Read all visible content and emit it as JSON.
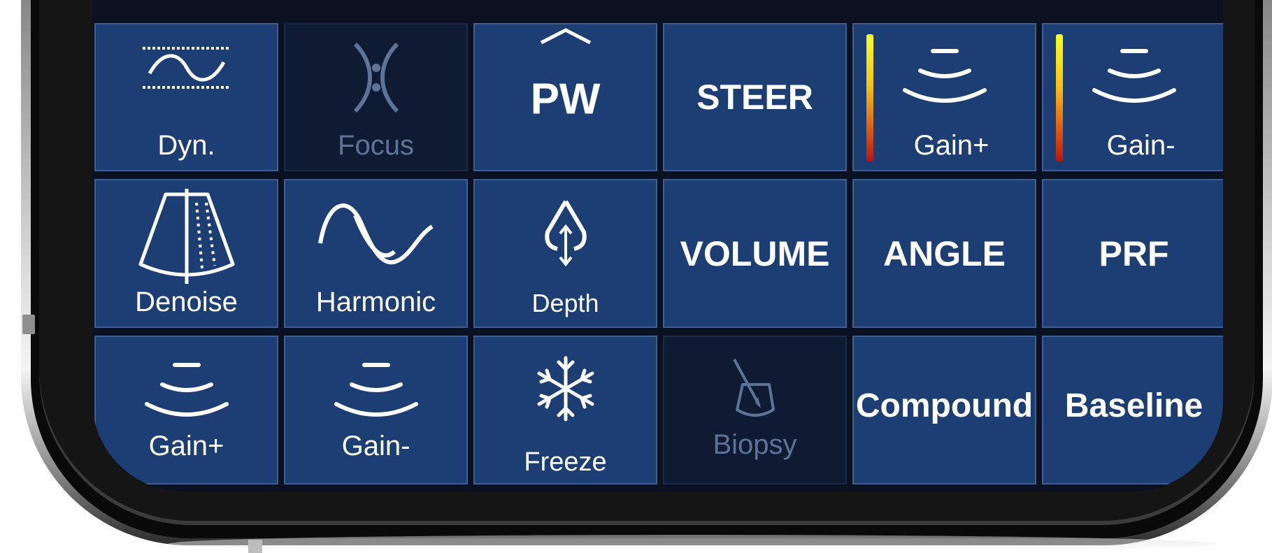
{
  "colors": {
    "tile": "#1c3e72",
    "tile_disabled": "#0f1a33",
    "tile_border": "#3f5f91",
    "text": "#ffffff",
    "text_disabled": "#5f7397"
  },
  "controls": {
    "row1": [
      {
        "label": "Dyn.",
        "icon": "dynamic-range-wave-icon",
        "enabled": true
      },
      {
        "label": "Focus",
        "icon": "focus-icon",
        "enabled": false
      },
      {
        "label": "PW",
        "icon": "chevron-up-icon",
        "enabled": true
      },
      {
        "label": "STEER",
        "enabled": true
      },
      {
        "label": "Gain+",
        "icon": "ultrasound-gain-icon",
        "enabled": true
      },
      {
        "label": "Gain-",
        "icon": "ultrasound-gain-icon",
        "enabled": true
      }
    ],
    "row2": [
      {
        "label": "Denoise",
        "icon": "sector-denoise-icon",
        "enabled": true
      },
      {
        "label": "Harmonic",
        "icon": "harmonic-wave-icon",
        "enabled": true
      },
      {
        "label": "Depth",
        "icon": "depth-arrow-icon",
        "enabled": true
      },
      {
        "label": "VOLUME",
        "enabled": true
      },
      {
        "label": "ANGLE",
        "enabled": true
      },
      {
        "label": "PRF",
        "enabled": true
      }
    ],
    "row3": [
      {
        "label": "Gain+",
        "icon": "ultrasound-gain-icon",
        "enabled": true
      },
      {
        "label": "Gain-",
        "icon": "ultrasound-gain-icon",
        "enabled": true
      },
      {
        "label": "Freeze",
        "icon": "snowflake-icon",
        "enabled": true
      },
      {
        "label": "Biopsy",
        "icon": "biopsy-needle-icon",
        "enabled": false
      },
      {
        "label": "Compound",
        "enabled": true
      },
      {
        "label": "Baseline",
        "enabled": true
      }
    ]
  }
}
